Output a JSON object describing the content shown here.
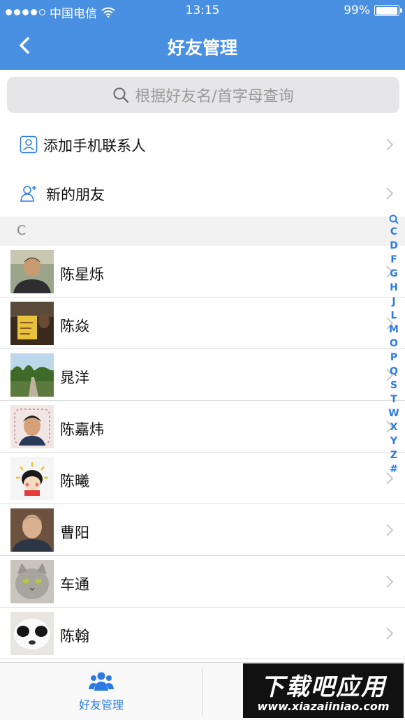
{
  "status_bar": {
    "carrier": "中国电信",
    "time": "13:15",
    "battery": "99%",
    "battery_level": 0.99
  },
  "nav": {
    "title": "好友管理"
  },
  "search": {
    "placeholder": "根据好友名/首字母查询"
  },
  "menu": [
    {
      "label": "添加手机联系人",
      "icon": "contact-card-icon"
    },
    {
      "label": "新的朋友",
      "icon": "add-friend-icon"
    }
  ],
  "section": {
    "letter": "C"
  },
  "contacts": [
    {
      "name": "陈星烁",
      "avatar": "avatar-photo"
    },
    {
      "name": "陈焱",
      "avatar": "avatar-photo"
    },
    {
      "name": "晁洋",
      "avatar": "avatar-photo"
    },
    {
      "name": "陈嘉炜",
      "avatar": "avatar-photo"
    },
    {
      "name": "陈曦",
      "avatar": "avatar-cartoon"
    },
    {
      "name": "曹阳",
      "avatar": "avatar-photo"
    },
    {
      "name": "车通",
      "avatar": "avatar-cat"
    },
    {
      "name": "陈翰",
      "avatar": "avatar-photo"
    }
  ],
  "index_letters": [
    "C",
    "D",
    "F",
    "G",
    "H",
    "J",
    "L",
    "M",
    "O",
    "P",
    "Q",
    "S",
    "T",
    "W",
    "X",
    "Y",
    "Z",
    "#"
  ],
  "tabbar": {
    "tab1_label": "好友管理"
  },
  "watermark": {
    "line1": "下载吧应用",
    "line2": "www.xiazaiiniao.com"
  },
  "colors": {
    "accent": "#4a90e2",
    "link": "#2c7be5"
  }
}
